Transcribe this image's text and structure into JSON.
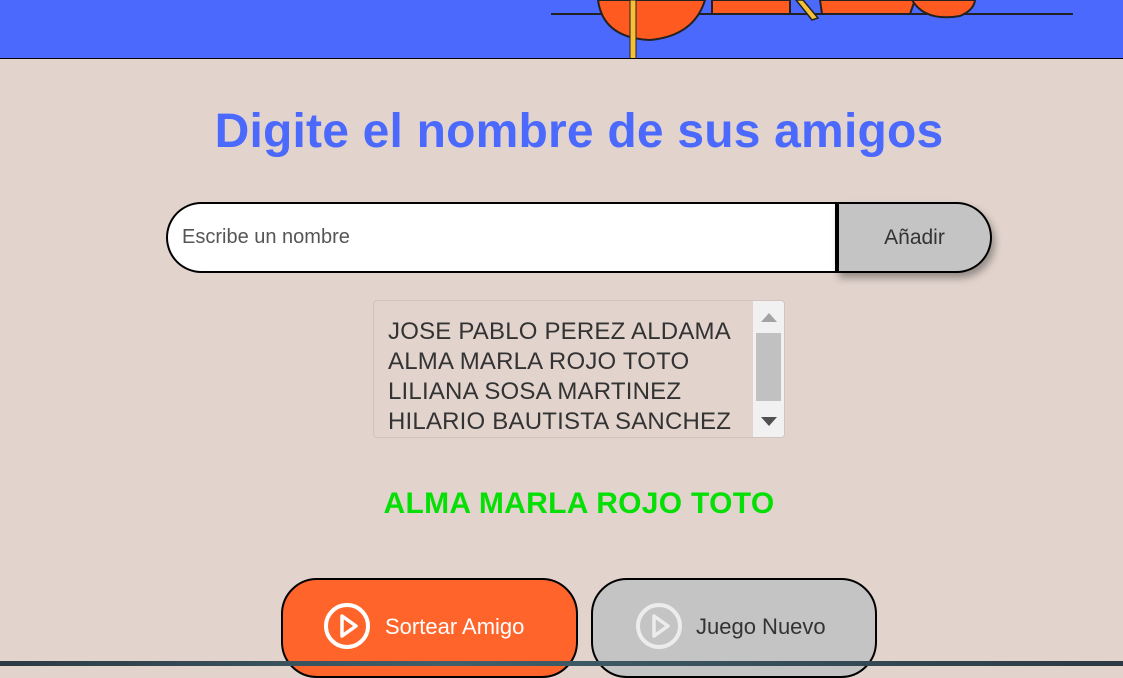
{
  "header": {
    "illustration": "decorative-header-illustration"
  },
  "main": {
    "title": "Digite el nombre de sus amigos",
    "name_input": {
      "placeholder": "Escribe un nombre",
      "value": ""
    },
    "add_button_label": "Añadir",
    "friends": [
      "JOSE PABLO PEREZ ALDAMA",
      "ALMA MARLA ROJO TOTO",
      "LILIANA SOSA MARTINEZ",
      "HILARIO BAUTISTA SANCHEZ"
    ],
    "result": "ALMA MARLA ROJO TOTO",
    "draw_button_label": "Sortear Amigo",
    "new_game_button_label": "Juego Nuevo"
  },
  "colors": {
    "header_bg": "#4b69fd",
    "page_bg": "#e2d4cd",
    "title": "#4b69fd",
    "result": "#05df05",
    "draw_button": "#ff652b",
    "secondary_button": "#c4c4c4"
  },
  "icons": {
    "draw_button": "play-circle-icon",
    "new_game_button": "play-circle-icon"
  }
}
